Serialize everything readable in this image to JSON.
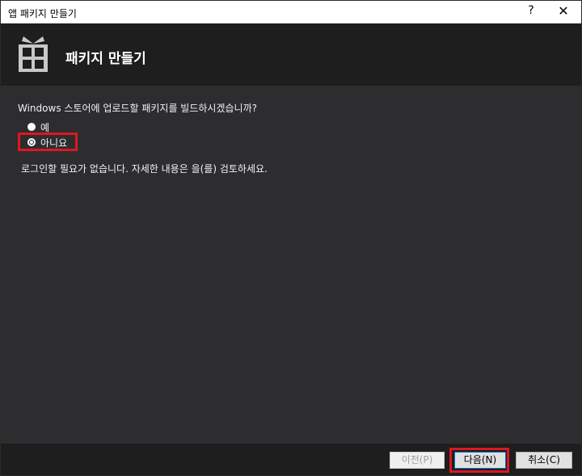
{
  "window": {
    "title": "앱 패키지 만들기",
    "help_label": "?",
    "close_label": "✕"
  },
  "header": {
    "title": "패키지 만들기",
    "icon": "gift-package-icon"
  },
  "content": {
    "question": "Windows 스토어에 업로드할 패키지를 빌드하시겠습니까?",
    "options": [
      {
        "label": "예",
        "selected": false
      },
      {
        "label": "아니요",
        "selected": true
      }
    ],
    "note": "로그인할 필요가 없습니다. 자세한 내용은 을(를) 검토하세요."
  },
  "footer": {
    "prev_label": "이전(P)",
    "next_label": "다음(N)",
    "cancel_label": "취소(C)"
  },
  "colors": {
    "highlight": "#e0161f",
    "header_bg": "#1e1e1e",
    "content_bg": "#2d2d30"
  }
}
